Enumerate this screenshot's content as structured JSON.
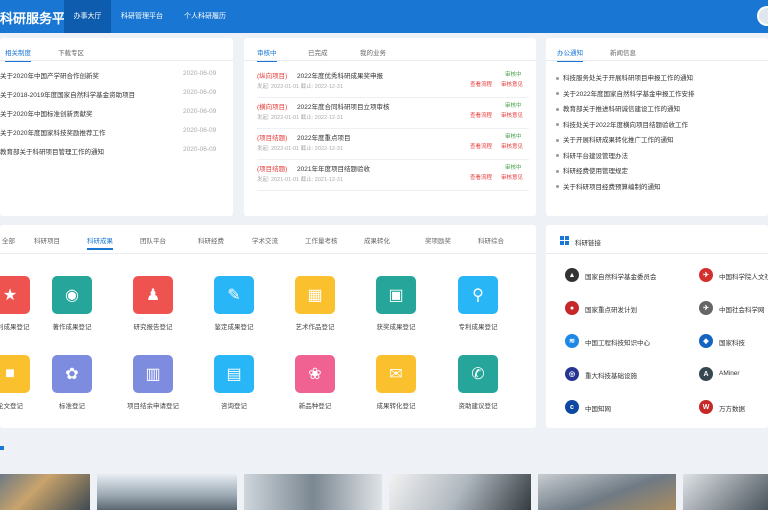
{
  "header": {
    "logo": "科研服务平台",
    "nav": [
      "办事大厅",
      "科研管理平台",
      "个人科研履历"
    ]
  },
  "policy": {
    "tabs": [
      "相关制度",
      "下载专区"
    ],
    "rows": [
      {
        "title": "关于2020年中国产学研合作创新奖",
        "date": "2020-06-09"
      },
      {
        "title": "关于2018-2019年度国家自然科学基金资助项目",
        "date": "2020-06-09"
      },
      {
        "title": "关于2020年中国标准创新贡献奖",
        "date": "2020-06-09"
      },
      {
        "title": "关于2020年度国家科技奖励推荐工作",
        "date": "2020-06-09"
      },
      {
        "title": "教育部关于科研项目管理工作的通知",
        "date": "2020-06-09"
      }
    ]
  },
  "business": {
    "tabs": [
      "审核中",
      "已完成",
      "我的业务"
    ],
    "items": [
      {
        "cat": "(纵向项目)",
        "title": "2022年度优秀科研成果奖申报",
        "meta": "发起: 2022-01-01  截止: 2022-12-31",
        "status": "审核中",
        "a1": "查看流程",
        "a2": "审核意见"
      },
      {
        "cat": "(横向项目)",
        "title": "2022年度合同科研项目立项审核",
        "meta": "发起: 2022-01-01  截止: 2022-12-31",
        "status": "审核中",
        "a1": "查看流程",
        "a2": "审核意见"
      },
      {
        "cat": "(项目结题)",
        "title": "2022年度重点项目",
        "meta": "发起: 2022-01-01  截止: 2022-12-31",
        "status": "审核中",
        "a1": "查看流程",
        "a2": "审核意见"
      },
      {
        "cat": "(项目结题)",
        "title": "2021年年度项目结题验收",
        "meta": "发起: 2021-01-01  截止: 2021-12-31",
        "status": "审核中",
        "a1": "查看流程",
        "a2": "审核意见"
      }
    ]
  },
  "notices": {
    "tabs": [
      "办公通知",
      "新闻信息"
    ],
    "items": [
      "科技服务处关于开展科研项目申报工作的通知",
      "关于2022年度国家自然科学基金申报工作安排",
      "教育部关于推进科研诚信建设工作的通知",
      "科技处关于2022年度横向项目结题验收工作",
      "关于开展科研成果转化推广工作的通知",
      "科研平台建设管理办法",
      "科研经费使用管理规定",
      "关于科研项目经费预算编制的通知"
    ]
  },
  "services": {
    "tabs": [
      "全部",
      "科研项目",
      "科研成果",
      "团队平台",
      "科研经费",
      "学术交流",
      "工作量考核",
      "成果转化",
      "奖项励奖",
      "科研综合"
    ],
    "row1": [
      {
        "label": "专利成果登记",
        "color": "#ef5350",
        "icon": "patent-icon",
        "glyph": "★"
      },
      {
        "label": "著作成果登记",
        "color": "#26a69a",
        "icon": "book-icon",
        "glyph": "◉"
      },
      {
        "label": "研究报告登记",
        "color": "#ef5350",
        "icon": "stamp-icon",
        "glyph": "♟"
      },
      {
        "label": "鉴定成果登记",
        "color": "#29b6f6",
        "icon": "ticket-icon",
        "glyph": "✎"
      },
      {
        "label": "艺术作品登记",
        "color": "#fbc02d",
        "icon": "art-icon",
        "glyph": "▦"
      },
      {
        "label": "获奖成果登记",
        "color": "#26a69a",
        "icon": "award-icon",
        "glyph": "▣"
      },
      {
        "label": "专利成果登记",
        "color": "#29b6f6",
        "icon": "search-icon",
        "glyph": "⚲"
      }
    ],
    "row2": [
      {
        "label": "论文登记",
        "color": "#fbc02d",
        "icon": "paper-icon",
        "glyph": "■"
      },
      {
        "label": "标准登记",
        "color": "#7e8ce0",
        "icon": "palette-icon",
        "glyph": "✿"
      },
      {
        "label": "项目结余申请登记",
        "color": "#7e8ce0",
        "icon": "books-icon",
        "glyph": "▥"
      },
      {
        "label": "咨询登记",
        "color": "#29b6f6",
        "icon": "document-icon",
        "glyph": "▤"
      },
      {
        "label": "新品种登记",
        "color": "#f06292",
        "icon": "flower-icon",
        "glyph": "❀"
      },
      {
        "label": "成果转化登记",
        "color": "#fbc02d",
        "icon": "inbox-icon",
        "glyph": "✉"
      },
      {
        "label": "资助建议登记",
        "color": "#26a69a",
        "icon": "chat-icon",
        "glyph": "✆"
      }
    ]
  },
  "links": {
    "title": "科研链接",
    "items": [
      {
        "label": "国家自然科学基金委员会",
        "color": "#333333",
        "icon": "nsfc-logo-icon",
        "glyph": "▲"
      },
      {
        "label": "中国科学院人文社会",
        "color": "#d32f2f",
        "icon": "cas-logo-icon",
        "glyph": "✈"
      },
      {
        "label": "国家重点研发计划",
        "color": "#c62828",
        "icon": "rd-plan-logo-icon",
        "glyph": "●"
      },
      {
        "label": "中国社会科学网",
        "color": "#666666",
        "icon": "cssn-logo-icon",
        "glyph": "✈"
      },
      {
        "label": "中国工程科技知识中心",
        "color": "#1e88e5",
        "icon": "ckcest-logo-icon",
        "glyph": "≋"
      },
      {
        "label": "国家科技",
        "color": "#1565c0",
        "icon": "national-tech-logo-icon",
        "glyph": "◆"
      },
      {
        "label": "重大科技基础设施",
        "color": "#283593",
        "icon": "facility-logo-icon",
        "glyph": "◎"
      },
      {
        "label": "AMiner",
        "color": "#37474f",
        "icon": "aminer-logo-icon",
        "glyph": "A"
      },
      {
        "label": "中国知网",
        "color": "#0d47a1",
        "icon": "cnki-logo-icon",
        "glyph": "c"
      },
      {
        "label": "万方数据",
        "color": "#c62828",
        "icon": "wanfang-logo-icon",
        "glyph": "W"
      }
    ]
  },
  "colors": {
    "primary": "#1976d2",
    "accent_red": "#e53935",
    "success": "#43a047"
  }
}
